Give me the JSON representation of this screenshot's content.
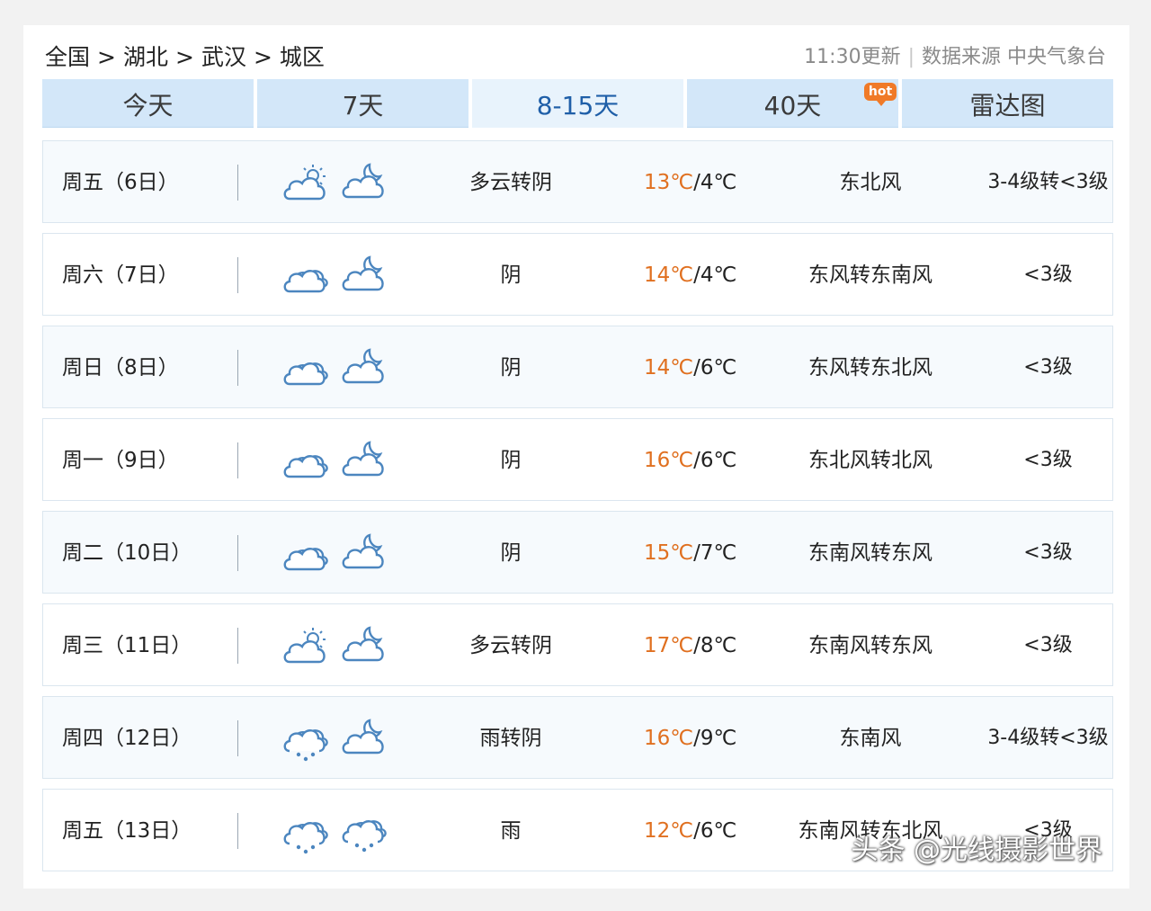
{
  "breadcrumb": {
    "items": [
      "全国",
      "湖北",
      "武汉",
      "城区"
    ],
    "separator": ">"
  },
  "header": {
    "updated": "11:30更新",
    "source": "数据来源 中央气象台"
  },
  "tabs": [
    {
      "label": "今天"
    },
    {
      "label": "7天"
    },
    {
      "label": "8-15天",
      "active": true
    },
    {
      "label": "40天",
      "badge": "hot"
    },
    {
      "label": "雷达图"
    }
  ],
  "forecast": [
    {
      "day": "周五（6日）",
      "day_icon": "partly-cloudy-day-icon",
      "night_icon": "partly-cloudy-night-icon",
      "condition": "多云转阴",
      "high": "13℃",
      "low": "4℃",
      "wind": "东北风",
      "level": "3-4级转<3级"
    },
    {
      "day": "周六（7日）",
      "day_icon": "overcast-icon",
      "night_icon": "partly-cloudy-night-icon",
      "condition": "阴",
      "high": "14℃",
      "low": "4℃",
      "wind": "东风转东南风",
      "level": "<3级"
    },
    {
      "day": "周日（8日）",
      "day_icon": "overcast-icon",
      "night_icon": "partly-cloudy-night-icon",
      "condition": "阴",
      "high": "14℃",
      "low": "6℃",
      "wind": "东风转东北风",
      "level": "<3级"
    },
    {
      "day": "周一（9日）",
      "day_icon": "overcast-icon",
      "night_icon": "partly-cloudy-night-icon",
      "condition": "阴",
      "high": "16℃",
      "low": "6℃",
      "wind": "东北风转北风",
      "level": "<3级"
    },
    {
      "day": "周二（10日）",
      "day_icon": "overcast-icon",
      "night_icon": "partly-cloudy-night-icon",
      "condition": "阴",
      "high": "15℃",
      "low": "7℃",
      "wind": "东南风转东风",
      "level": "<3级"
    },
    {
      "day": "周三（11日）",
      "day_icon": "partly-cloudy-day-icon",
      "night_icon": "partly-cloudy-night-icon",
      "condition": "多云转阴",
      "high": "17℃",
      "low": "8℃",
      "wind": "东南风转东风",
      "level": "<3级"
    },
    {
      "day": "周四（12日）",
      "day_icon": "rain-icon",
      "night_icon": "partly-cloudy-night-icon",
      "condition": "雨转阴",
      "high": "16℃",
      "low": "9℃",
      "wind": "东南风",
      "level": "3-4级转<3级"
    },
    {
      "day": "周五（13日）",
      "day_icon": "rain-icon",
      "night_icon": "rain-icon",
      "condition": "雨",
      "high": "12℃",
      "low": "6℃",
      "wind": "东南风转东北风",
      "level": "<3级"
    }
  ],
  "watermark": "头条 @光线摄影世界",
  "colors": {
    "tab_bg": "#d3e7f9",
    "tab_active_bg": "#e8f3fc",
    "tab_active_text": "#1f5fa8",
    "temp_high": "#e07020",
    "icon_stroke": "#4c86bf",
    "hot_badge": "#f07a28"
  }
}
